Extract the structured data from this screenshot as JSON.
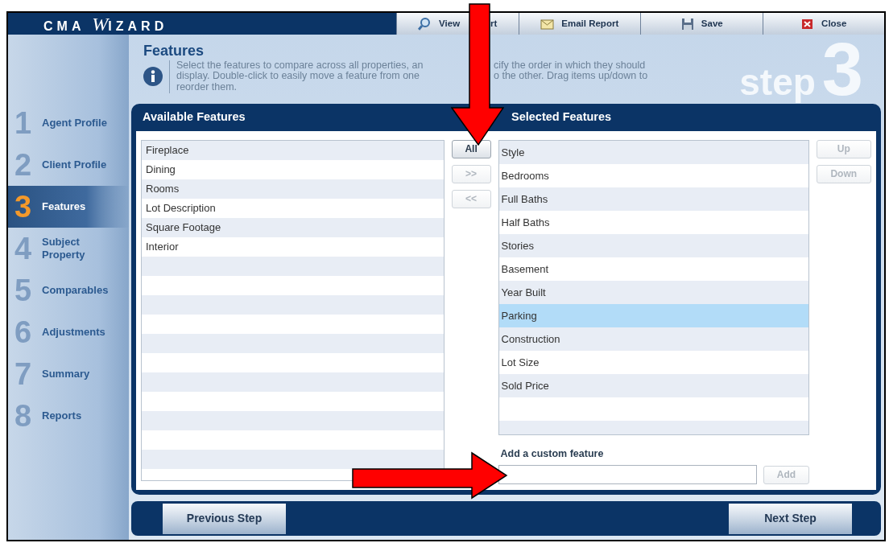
{
  "app": {
    "logo": "CMA WIZARD"
  },
  "toolbar": [
    {
      "kind": "view",
      "label": "View",
      "label_tail": "rt"
    },
    {
      "kind": "email",
      "label": "Email Report"
    },
    {
      "kind": "save",
      "label": "Save"
    },
    {
      "kind": "close",
      "label": "Close"
    }
  ],
  "steps": [
    {
      "number": "1",
      "label": "Agent Profile",
      "selected": false
    },
    {
      "number": "2",
      "label": "Client Profile",
      "selected": false
    },
    {
      "number": "3",
      "label": "Features",
      "selected": true
    },
    {
      "number": "4",
      "label": "Subject Property",
      "selected": false
    },
    {
      "number": "5",
      "label": "Comparables",
      "selected": false
    },
    {
      "number": "6",
      "label": "Adjustments",
      "selected": false
    },
    {
      "number": "7",
      "label": "Summary",
      "selected": false
    },
    {
      "number": "8",
      "label": "Reports",
      "selected": false
    }
  ],
  "header": {
    "title": "Features",
    "description_lines": [
      [
        "Select the features to compare across all properties, an",
        "cify the order in which they should"
      ],
      [
        "display. Double-click to easily move a feature from one",
        "o the other. Drag items up/down to"
      ],
      [
        "reorder them."
      ]
    ],
    "step_word": "step",
    "step_number": "3"
  },
  "available": {
    "title": "Available Features",
    "items": [
      {
        "label": "Fireplace",
        "selected": false
      },
      {
        "label": "Dining",
        "selected": false
      },
      {
        "label": "Rooms",
        "selected": false
      },
      {
        "label": "Lot Description",
        "selected": false
      },
      {
        "label": "Square Footage",
        "selected": false
      },
      {
        "label": "Interior",
        "selected": false
      }
    ]
  },
  "move_buttons": [
    {
      "label": "All",
      "disabled": false
    },
    {
      "label": ">>",
      "disabled": true
    },
    {
      "label": "<<",
      "disabled": true
    }
  ],
  "selected_features": {
    "title": "Selected Features",
    "items": [
      {
        "label": "Style",
        "selected": false
      },
      {
        "label": "Bedrooms",
        "selected": false
      },
      {
        "label": "Full Baths",
        "selected": false
      },
      {
        "label": "Half Baths",
        "selected": false
      },
      {
        "label": "Stories",
        "selected": false
      },
      {
        "label": "Basement",
        "selected": false
      },
      {
        "label": "Year Built",
        "selected": false
      },
      {
        "label": "Parking",
        "selected": true
      },
      {
        "label": "Construction",
        "selected": false
      },
      {
        "label": "Lot Size",
        "selected": false
      },
      {
        "label": "Sold Price",
        "selected": false
      }
    ]
  },
  "order_buttons": [
    {
      "label": "Up",
      "disabled": true
    },
    {
      "label": "Down",
      "disabled": true
    }
  ],
  "custom_feature": {
    "label": "Add a custom feature",
    "button": {
      "label": "Add",
      "disabled": true
    }
  },
  "footer": {
    "previous": "Previous Step",
    "next": "Next Step"
  }
}
